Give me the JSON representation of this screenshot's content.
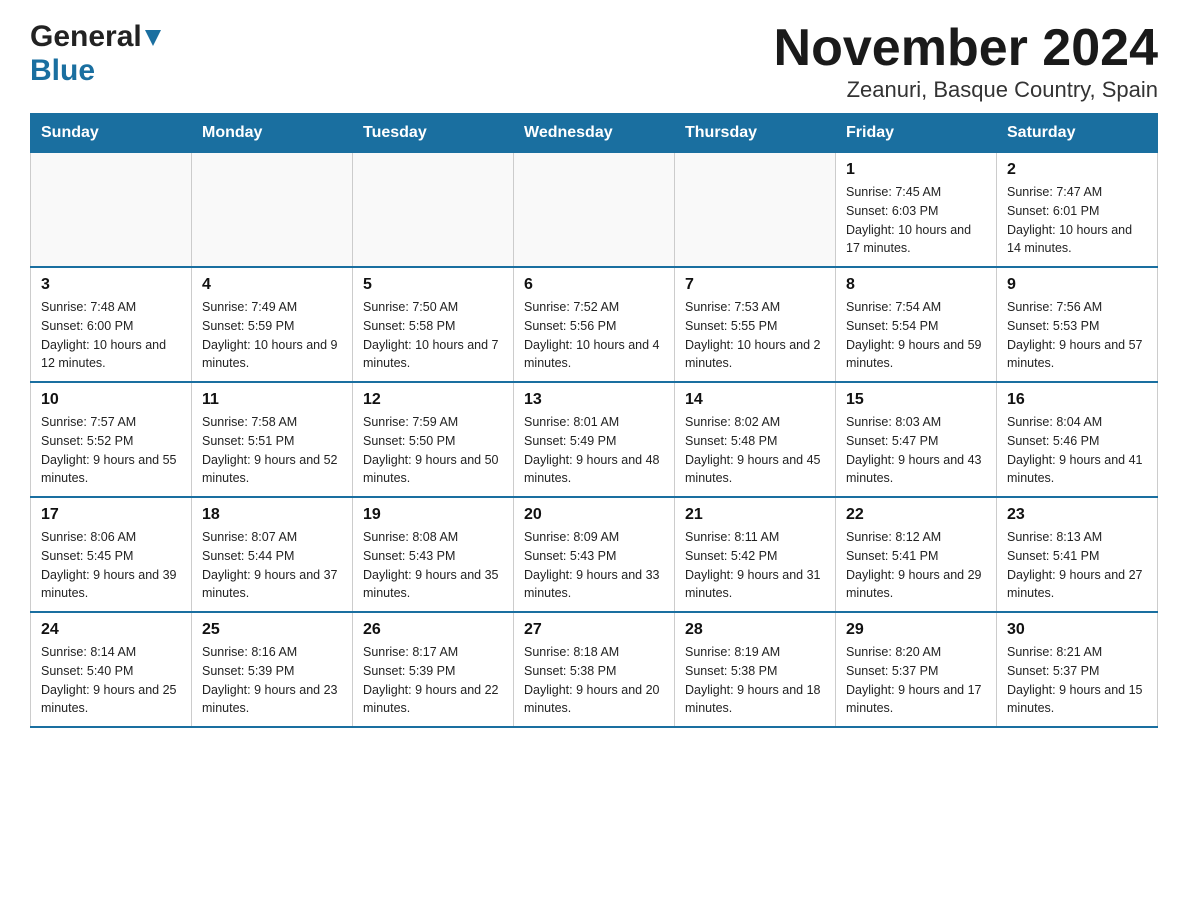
{
  "header": {
    "title": "November 2024",
    "subtitle": "Zeanuri, Basque Country, Spain",
    "logo_general": "General",
    "logo_blue": "Blue"
  },
  "days_of_week": [
    "Sunday",
    "Monday",
    "Tuesday",
    "Wednesday",
    "Thursday",
    "Friday",
    "Saturday"
  ],
  "weeks": [
    [
      {
        "day": "",
        "info": ""
      },
      {
        "day": "",
        "info": ""
      },
      {
        "day": "",
        "info": ""
      },
      {
        "day": "",
        "info": ""
      },
      {
        "day": "",
        "info": ""
      },
      {
        "day": "1",
        "info": "Sunrise: 7:45 AM\nSunset: 6:03 PM\nDaylight: 10 hours and 17 minutes."
      },
      {
        "day": "2",
        "info": "Sunrise: 7:47 AM\nSunset: 6:01 PM\nDaylight: 10 hours and 14 minutes."
      }
    ],
    [
      {
        "day": "3",
        "info": "Sunrise: 7:48 AM\nSunset: 6:00 PM\nDaylight: 10 hours and 12 minutes."
      },
      {
        "day": "4",
        "info": "Sunrise: 7:49 AM\nSunset: 5:59 PM\nDaylight: 10 hours and 9 minutes."
      },
      {
        "day": "5",
        "info": "Sunrise: 7:50 AM\nSunset: 5:58 PM\nDaylight: 10 hours and 7 minutes."
      },
      {
        "day": "6",
        "info": "Sunrise: 7:52 AM\nSunset: 5:56 PM\nDaylight: 10 hours and 4 minutes."
      },
      {
        "day": "7",
        "info": "Sunrise: 7:53 AM\nSunset: 5:55 PM\nDaylight: 10 hours and 2 minutes."
      },
      {
        "day": "8",
        "info": "Sunrise: 7:54 AM\nSunset: 5:54 PM\nDaylight: 9 hours and 59 minutes."
      },
      {
        "day": "9",
        "info": "Sunrise: 7:56 AM\nSunset: 5:53 PM\nDaylight: 9 hours and 57 minutes."
      }
    ],
    [
      {
        "day": "10",
        "info": "Sunrise: 7:57 AM\nSunset: 5:52 PM\nDaylight: 9 hours and 55 minutes."
      },
      {
        "day": "11",
        "info": "Sunrise: 7:58 AM\nSunset: 5:51 PM\nDaylight: 9 hours and 52 minutes."
      },
      {
        "day": "12",
        "info": "Sunrise: 7:59 AM\nSunset: 5:50 PM\nDaylight: 9 hours and 50 minutes."
      },
      {
        "day": "13",
        "info": "Sunrise: 8:01 AM\nSunset: 5:49 PM\nDaylight: 9 hours and 48 minutes."
      },
      {
        "day": "14",
        "info": "Sunrise: 8:02 AM\nSunset: 5:48 PM\nDaylight: 9 hours and 45 minutes."
      },
      {
        "day": "15",
        "info": "Sunrise: 8:03 AM\nSunset: 5:47 PM\nDaylight: 9 hours and 43 minutes."
      },
      {
        "day": "16",
        "info": "Sunrise: 8:04 AM\nSunset: 5:46 PM\nDaylight: 9 hours and 41 minutes."
      }
    ],
    [
      {
        "day": "17",
        "info": "Sunrise: 8:06 AM\nSunset: 5:45 PM\nDaylight: 9 hours and 39 minutes."
      },
      {
        "day": "18",
        "info": "Sunrise: 8:07 AM\nSunset: 5:44 PM\nDaylight: 9 hours and 37 minutes."
      },
      {
        "day": "19",
        "info": "Sunrise: 8:08 AM\nSunset: 5:43 PM\nDaylight: 9 hours and 35 minutes."
      },
      {
        "day": "20",
        "info": "Sunrise: 8:09 AM\nSunset: 5:43 PM\nDaylight: 9 hours and 33 minutes."
      },
      {
        "day": "21",
        "info": "Sunrise: 8:11 AM\nSunset: 5:42 PM\nDaylight: 9 hours and 31 minutes."
      },
      {
        "day": "22",
        "info": "Sunrise: 8:12 AM\nSunset: 5:41 PM\nDaylight: 9 hours and 29 minutes."
      },
      {
        "day": "23",
        "info": "Sunrise: 8:13 AM\nSunset: 5:41 PM\nDaylight: 9 hours and 27 minutes."
      }
    ],
    [
      {
        "day": "24",
        "info": "Sunrise: 8:14 AM\nSunset: 5:40 PM\nDaylight: 9 hours and 25 minutes."
      },
      {
        "day": "25",
        "info": "Sunrise: 8:16 AM\nSunset: 5:39 PM\nDaylight: 9 hours and 23 minutes."
      },
      {
        "day": "26",
        "info": "Sunrise: 8:17 AM\nSunset: 5:39 PM\nDaylight: 9 hours and 22 minutes."
      },
      {
        "day": "27",
        "info": "Sunrise: 8:18 AM\nSunset: 5:38 PM\nDaylight: 9 hours and 20 minutes."
      },
      {
        "day": "28",
        "info": "Sunrise: 8:19 AM\nSunset: 5:38 PM\nDaylight: 9 hours and 18 minutes."
      },
      {
        "day": "29",
        "info": "Sunrise: 8:20 AM\nSunset: 5:37 PM\nDaylight: 9 hours and 17 minutes."
      },
      {
        "day": "30",
        "info": "Sunrise: 8:21 AM\nSunset: 5:37 PM\nDaylight: 9 hours and 15 minutes."
      }
    ]
  ]
}
